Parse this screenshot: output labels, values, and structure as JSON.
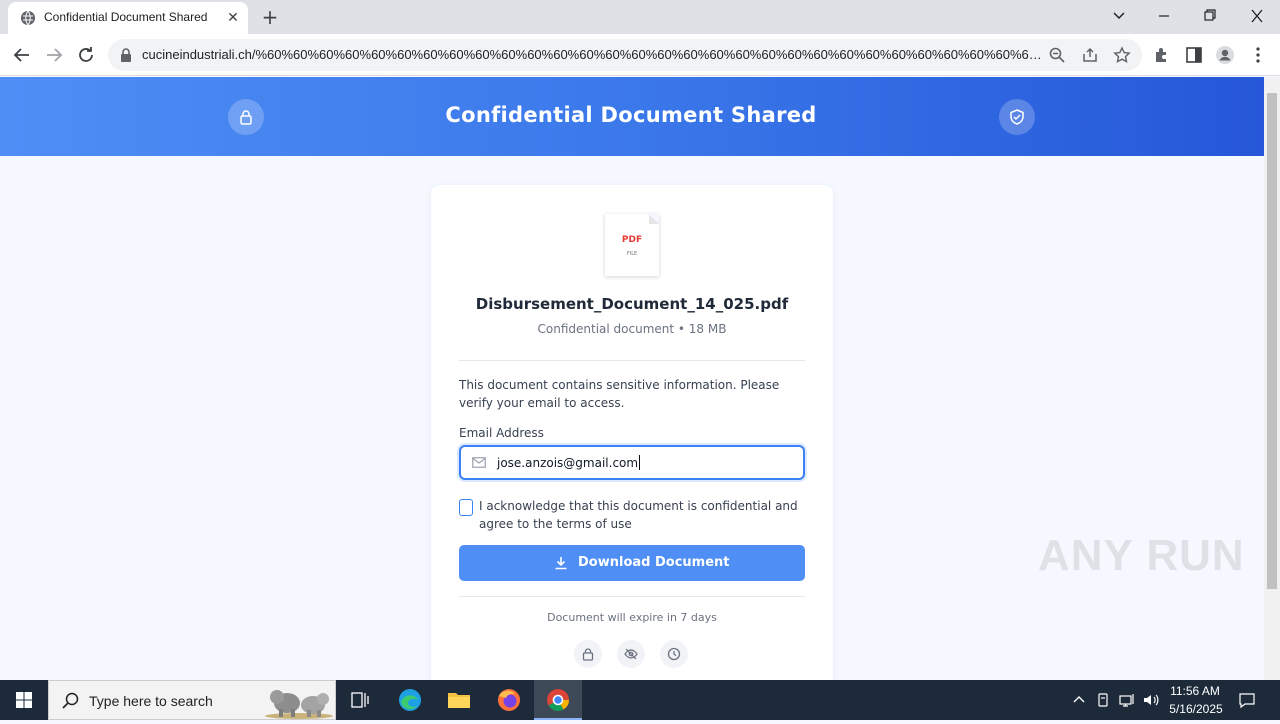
{
  "browser": {
    "tab_title": "Confidential Document Shared",
    "tab_close": "✕",
    "new_tab": "+",
    "url": "cucineindustriali.ch/%60%60%60%60%60%60%60%60%60%60%60%60%60%60%60%60%60%60%60%60%60%60%60%60%60%60%60%60%60%60%60%..."
  },
  "page": {
    "banner_title": "Confidential Document Shared",
    "file_type": "PDF",
    "file_type_sub": "FILE",
    "file_name": "Disbursement_Document_14_025.pdf",
    "file_meta": "Confidential document • 18 MB",
    "notice": "This document contains sensitive information. Please verify your email to access.",
    "email_label": "Email Address",
    "email_value": "jose.anzois@gmail.com",
    "acknowledge_text": "I acknowledge that this document is confidential and agree to the terms of use",
    "acknowledge_checked": false,
    "download_label": "Download Document",
    "expiry_text": "Document will expire in 7 days"
  },
  "watermark": "ANY RUN",
  "taskbar": {
    "search_placeholder": "Type here to search",
    "time": "11:56 AM",
    "date": "5/16/2025"
  },
  "colors": {
    "banner_start": "#4e8ef5",
    "banner_end": "#2557d8",
    "accent": "#3b82f6",
    "button": "#4e8ef5",
    "pdf_red": "#e53935"
  }
}
